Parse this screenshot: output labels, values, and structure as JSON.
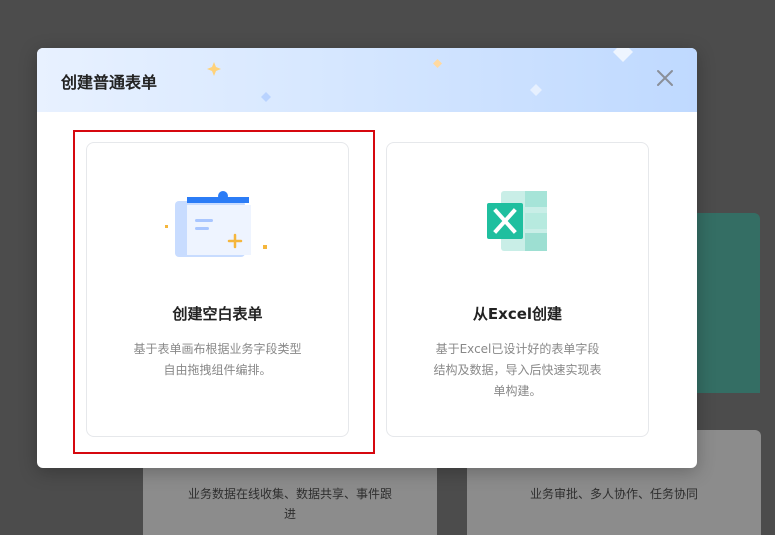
{
  "background": {
    "left_card_text": "业务数据在线收集、数据共享、事件跟进",
    "right_card_text": "业务审批、多人协作、任务协同"
  },
  "dialog": {
    "title": "创建普通表单",
    "close_icon": "close-icon"
  },
  "options": {
    "blank": {
      "title": "创建空白表单",
      "description": "基于表单画布根据业务字段类型自由拖拽组件编排。",
      "icon": "blank-form-icon"
    },
    "excel": {
      "title": "从Excel创建",
      "description": "基于Excel已设计好的表单字段结构及数据，导入后快速实现表单构建。",
      "icon": "excel-icon"
    }
  },
  "colors": {
    "highlight": "#d6080f",
    "excel_green": "#1fbf9f",
    "primary_blue": "#2b7cf6"
  }
}
